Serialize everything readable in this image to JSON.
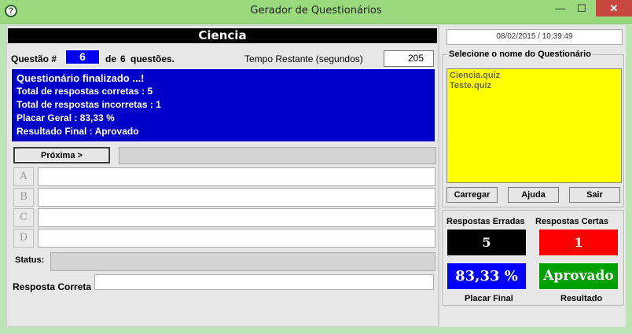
{
  "window": {
    "title": "Gerador de Questionários",
    "app_icon": "?",
    "minimize": "—",
    "maximize": "☐",
    "close": "✕"
  },
  "quiz": {
    "title": "Ciencia",
    "question_label": "Questão #",
    "question_number": "6",
    "of_label": "de",
    "total_questions": "6",
    "questions_label": "questões.",
    "time_label": "Tempo Restante (segundos)",
    "time_value": "205"
  },
  "result": {
    "lines": [
      "Questionário finalizado ...!",
      "Total de respostas corretas :  5",
      "Total de respostas incorretas :  1",
      "Placar Geral    :  83,33 %",
      "Resultado Final :  Aprovado"
    ]
  },
  "controls": {
    "next_label": "Próxima >",
    "options": [
      "A",
      "B",
      "C",
      "D"
    ],
    "option_values": [
      "",
      "",
      "",
      ""
    ],
    "status_label": "Status:",
    "status_value": "",
    "correct_answer_label": "Resposta Correta",
    "correct_answer_value": ""
  },
  "side": {
    "datetime": "08/02/2015 / 10:39:49",
    "select_label": "Selecione o nome do Questionário",
    "quiz_files": [
      "Ciencia.quiz",
      "Teste.quiz"
    ],
    "load_label": "Carregar",
    "help_label": "Ajuda",
    "exit_label": "Sair"
  },
  "stats": {
    "wrong_label": "Respostas Erradas",
    "wrong_value": "5",
    "right_label": "Respostas Certas",
    "right_value": "1",
    "score_value": "83,33 %",
    "score_label": "Placar Final",
    "outcome_value": "Aprovado",
    "outcome_label": "Resultado"
  },
  "colors": {
    "window_bg": "#bde5b4",
    "title_bg": "#000000",
    "question_number_bg": "#0000ee",
    "result_bg": "#0000c8",
    "list_bg": "#ffff00",
    "wrong_bg": "#000000",
    "right_bg": "#ff0000",
    "score_bg": "#0000ff",
    "outcome_bg": "#00a000",
    "close_button": "#c7463d"
  }
}
